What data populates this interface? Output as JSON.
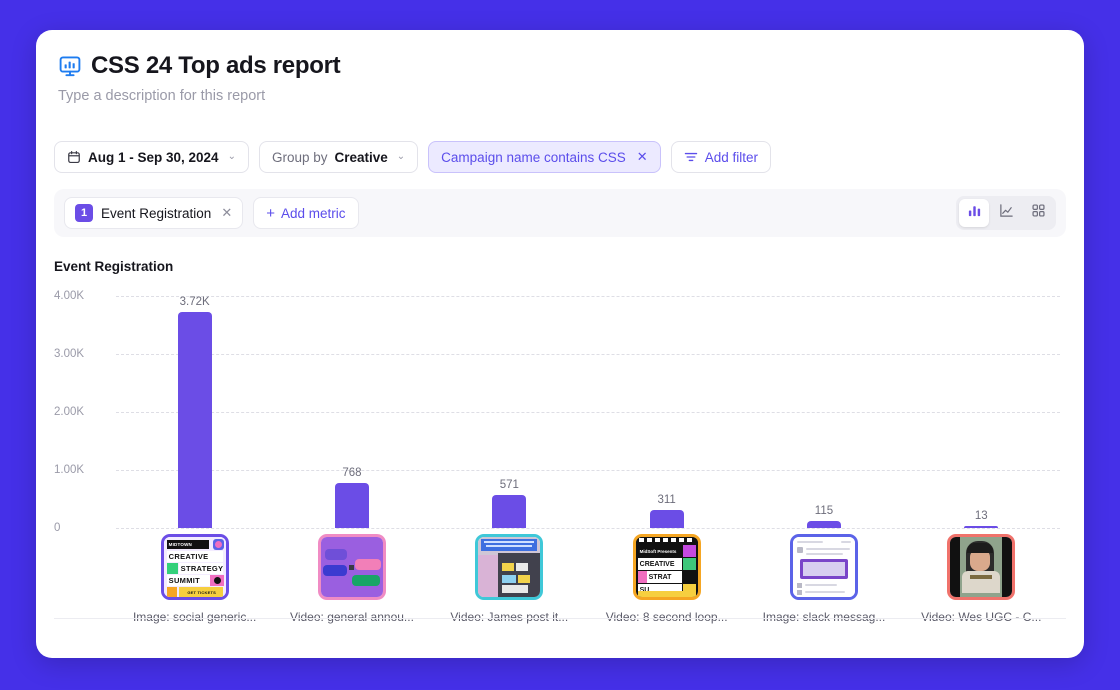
{
  "page": {
    "background_color": "#4530E8",
    "accent_color": "#5B4DEB",
    "bar_color": "#6B4DE6"
  },
  "header": {
    "icon": "report-board-chart-icon",
    "title": "CSS 24 Top ads report",
    "description_placeholder": "Type a description for this report"
  },
  "filters": {
    "date_range": {
      "icon": "calendar-icon",
      "label": "Aug 1 - Sep 30, 2024",
      "caret": "⌄"
    },
    "group_by": {
      "prefix": "Group by",
      "value": "Creative",
      "caret": "⌄"
    },
    "active_filter": {
      "label": "Campaign name contains CSS",
      "remove": "✕"
    },
    "add_filter": {
      "icon": "filter-icon",
      "label": "Add filter"
    }
  },
  "metrics": {
    "chip": {
      "index": "1",
      "label": "Event Registration",
      "remove": "✕"
    },
    "add_metric": {
      "plus": "+",
      "label": "Add metric"
    },
    "views": [
      {
        "name": "bar-chart-view",
        "active": true
      },
      {
        "name": "line-chart-view",
        "active": false
      },
      {
        "name": "grid-view",
        "active": false
      }
    ]
  },
  "chart_data": {
    "type": "bar",
    "title": "Event Registration",
    "xlabel": "",
    "ylabel": "Event Registration",
    "ylim": [
      0,
      4000
    ],
    "yticks": [
      4000,
      3000,
      2000,
      1000,
      0
    ],
    "ytick_labels": [
      "4.00K",
      "3.00K",
      "2.00K",
      "1.00K",
      "0"
    ],
    "grid": true,
    "legend": "none",
    "categories": [
      "Image: social generic...",
      "Video: general annou...",
      "Video: James post it...",
      "Video: 8 second loop...",
      "Image: slack messag...",
      "Video: Wes UGC - C..."
    ],
    "values": [
      3720,
      768,
      571,
      311,
      115,
      13
    ],
    "value_labels": [
      "3.72K",
      "768",
      "571",
      "311",
      "115",
      "13"
    ],
    "bar_color": "#6B4DE6",
    "thumbnails": [
      {
        "name": "creative-strategy-summit-poster-thumbnail",
        "border_color": "#6B4DE6"
      },
      {
        "name": "purple-tags-announcement-thumbnail",
        "border_color": "#F08CC4"
      },
      {
        "name": "james-post-it-notes-video-thumbnail",
        "border_color": "#3FC8D8"
      },
      {
        "name": "8-second-loop-filmstrip-thumbnail",
        "border_color": "#F5A623"
      },
      {
        "name": "slack-message-screenshot-thumbnail",
        "border_color": "#5B63E8"
      },
      {
        "name": "wes-ugc-person-video-thumbnail",
        "border_color": "#F0726B"
      }
    ]
  }
}
